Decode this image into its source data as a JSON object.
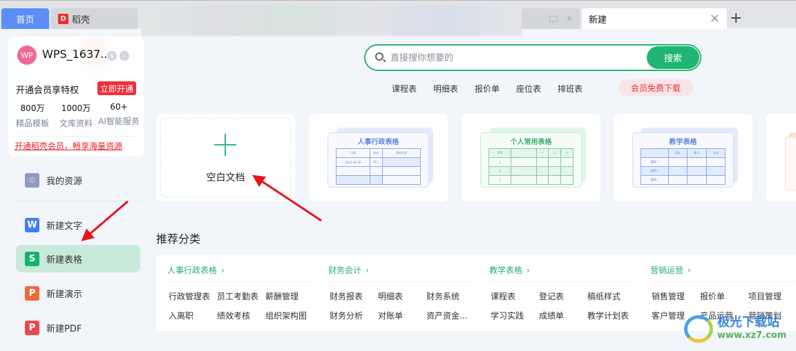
{
  "tabs": {
    "home": "首页",
    "daoke": "稻壳",
    "daoke_logo": "D",
    "active": "新建",
    "close_glyph": "×",
    "add_glyph": "+"
  },
  "member": {
    "avatar_initials": "WP",
    "username": "WPS_1637...",
    "badges": [
      "S",
      "✓"
    ],
    "vip_text": "开通会员享特权",
    "vip_button": "立即开通",
    "stats": [
      {
        "value": "800万",
        "label": "精品模板"
      },
      {
        "value": "1000万",
        "label": "文库资料"
      },
      {
        "value": "60+",
        "label": "AI智能服务"
      }
    ],
    "promo_link": "开通稻壳会员，畅享海量资源"
  },
  "sidebar": {
    "items": [
      {
        "label": "我的资源",
        "icon": "☆",
        "color": "#8f9bbe"
      },
      {
        "label": "新建文字",
        "icon": "W",
        "color": "#3f7ef0"
      },
      {
        "label": "新建表格",
        "icon": "S",
        "color": "#17b26c",
        "active": true
      },
      {
        "label": "新建演示",
        "icon": "P",
        "color": "#ee6a3c"
      },
      {
        "label": "新建PDF",
        "icon": "P",
        "color": "#e9474c"
      }
    ]
  },
  "search": {
    "placeholder": "直接搜你想要的",
    "value": "",
    "button": "搜索",
    "quick_links": [
      "课程表",
      "明细表",
      "报价单",
      "座位表",
      "排班表"
    ],
    "vip_download": "会员免费下载"
  },
  "templates": {
    "blank_label": "空白文档",
    "cards": [
      {
        "title": "人事行政表格",
        "accent": "#6d8fe0",
        "rows": [
          [
            "日期",
            "姓名",
            "请假信息"
          ],
          [
            "2022.06.08",
            "张三",
            ""
          ],
          [
            "",
            "",
            ""
          ],
          [
            "",
            "",
            ""
          ]
        ]
      },
      {
        "title": "个人常用表格",
        "accent": "#47b57a",
        "rows": [
          [
            "序号",
            "",
            "一",
            "二",
            "三"
          ],
          [
            "1",
            "",
            "",
            "",
            ""
          ],
          [
            "2",
            "",
            "",
            "",
            ""
          ],
          [
            "3",
            "",
            "",
            "",
            ""
          ]
        ]
      },
      {
        "title": "教学表格",
        "accent": "#6d8fe0",
        "rows": [
          [
            "",
            "语文",
            "数学",
            "外语"
          ],
          [
            "星期一",
            "",
            "",
            ""
          ],
          [
            "星期二",
            "",
            "",
            ""
          ],
          [
            "星期三",
            "",
            "",
            ""
          ]
        ]
      }
    ]
  },
  "recommend": {
    "title": "推荐分类",
    "categories": [
      {
        "name": "人事行政表格",
        "items": [
          "行政管理表",
          "员工考勤表",
          "薪酬管理",
          "入离职",
          "绩效考核",
          "组织架构图"
        ]
      },
      {
        "name": "财务会计",
        "items": [
          "财务报表",
          "明细表",
          "财务系统",
          "财务分析",
          "对账单",
          "资产资金..."
        ]
      },
      {
        "name": "教学表格",
        "items": [
          "课程表",
          "登记表",
          "稿纸样式",
          "学习实践",
          "成绩单",
          "教学计划表"
        ]
      },
      {
        "name": "营销运营",
        "items": [
          "销售管理",
          "报价单",
          "项目管理",
          "客户管理",
          "产品运营",
          "营销策划"
        ]
      }
    ],
    "chevron": "›"
  },
  "watermark": {
    "title": "极光下载站",
    "url": "www.xz7.com"
  }
}
